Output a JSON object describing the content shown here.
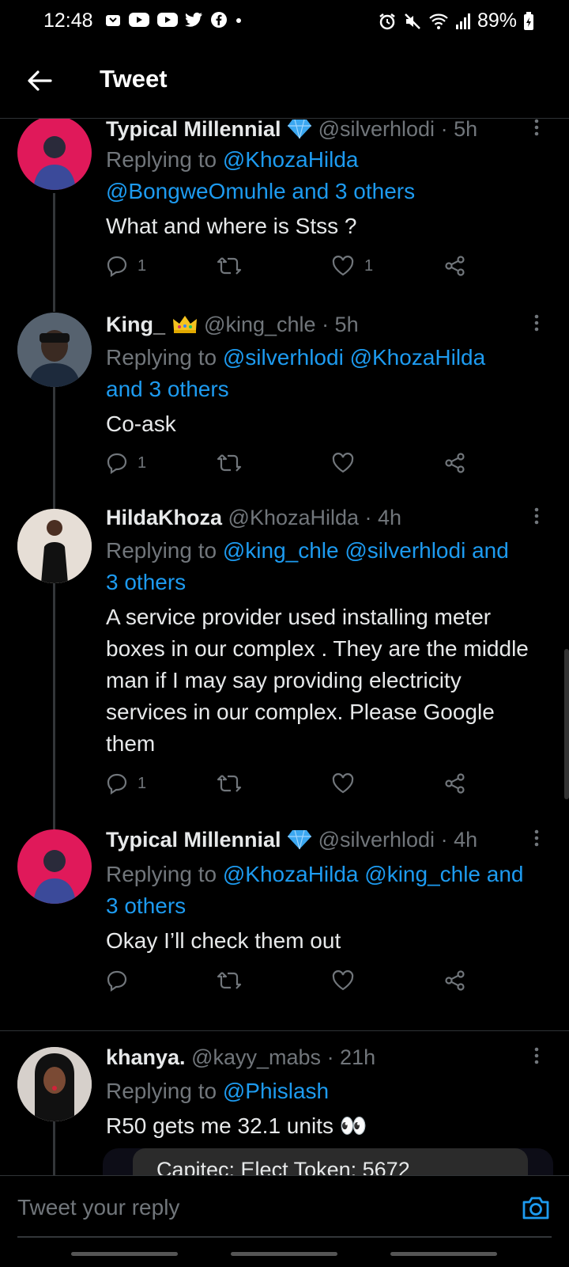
{
  "status_bar": {
    "time": "12:48",
    "battery": "89%"
  },
  "header": {
    "title": "Tweet"
  },
  "tweets": [
    {
      "name": "Typical Millennial",
      "handle": "@silverhlodi",
      "time": "· 5h",
      "replying_prefix": "Replying to ",
      "replying_line1": "@KhozaHilda",
      "replying_line2": "@BongweOmuhle and 3 others",
      "text": "What and where is Stss ?",
      "reply_count": "1",
      "retweet_count": "",
      "like_count": "1",
      "avatar_color": "#e0195a"
    },
    {
      "name": "King_",
      "handle": "@king_chle",
      "time": "· 5h",
      "replying_prefix": "Replying to ",
      "replying_line1": "@silverhlodi @KhozaHilda",
      "replying_line2": "and 3 others",
      "text": "Co-ask",
      "reply_count": "1",
      "retweet_count": "",
      "like_count": "",
      "avatar_color": "#3a4a5c"
    },
    {
      "name": "HildaKhoza",
      "handle": "@KhozaHilda",
      "time": "· 4h",
      "replying_prefix": "Replying to ",
      "replying_line1": "@king_chle @silverhlodi and",
      "replying_line2": "3 others",
      "text": "A service provider used installing meter boxes in our complex . They are the middle man if I may say providing electricity services in our complex. Please Google them",
      "reply_count": "1",
      "retweet_count": "",
      "like_count": "",
      "avatar_color": "#d8cfc6"
    },
    {
      "name": "Typical Millennial",
      "handle": "@silverhlodi",
      "time": "· 4h",
      "replying_prefix": "Replying to ",
      "replying_line1": "@KhozaHilda @king_chle and",
      "replying_line2": "3 others",
      "text": "Okay I’ll check them out",
      "reply_count": "",
      "retweet_count": "",
      "like_count": "",
      "avatar_color": "#e0195a"
    },
    {
      "name": "khanya.",
      "handle": "@kayy_mabs",
      "time": "· 21h",
      "replying_prefix": "Replying to ",
      "replying_line1": "@Phislash",
      "replying_line2": "",
      "text": "R50 gets me 32.1 units 👀",
      "media_text": "Capitec: Elect Token: 5672",
      "avatar_color": "#c9c4c0"
    }
  ],
  "reply_bar": {
    "placeholder": "Tweet your reply"
  },
  "colors": {
    "accent": "#1d9bf0",
    "muted": "#71767b",
    "background": "#000000"
  }
}
